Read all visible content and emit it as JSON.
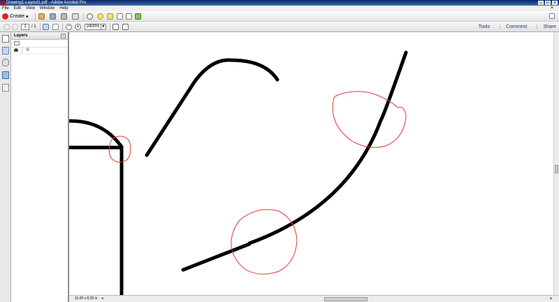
{
  "window": {
    "title": "Drawing1-Layout1.pdf - Adobe Acrobat Pro",
    "controls": [
      "_",
      "□",
      "×"
    ]
  },
  "menu": {
    "items": [
      "File",
      "Edit",
      "View",
      "Window",
      "Help"
    ],
    "close_doc": "×"
  },
  "toolbar": {
    "create_label": "Create",
    "create_arrow": "▾"
  },
  "navigation": {
    "current_page": "1",
    "page_total": "/ 1",
    "zoom_value": "2400%",
    "zoom_arrow": "▾",
    "zoom_out": "−",
    "zoom_in": "+"
  },
  "panes": {
    "tools": "Tools",
    "comment": "Comment",
    "share": "Share"
  },
  "layers_panel": {
    "title": "Layers",
    "close": "×",
    "layers": [
      {
        "name": "0",
        "visible": true
      }
    ]
  },
  "status": {
    "page_size": "11,00 x 8,26 in",
    "scroll_left": "◂",
    "scroll_right": "▸"
  },
  "colors": {
    "drawing_stroke": "#000000",
    "markup_cloud": "#e03a3a",
    "accent_red": "#cc0000"
  }
}
